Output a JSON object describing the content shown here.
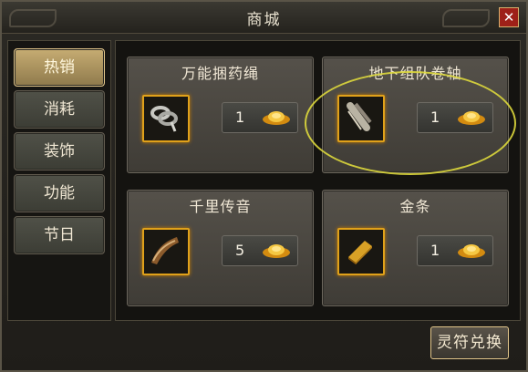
{
  "window": {
    "title": "商城"
  },
  "sidebar": {
    "tabs": [
      {
        "label": "热销",
        "active": true
      },
      {
        "label": "消耗",
        "active": false
      },
      {
        "label": "装饰",
        "active": false
      },
      {
        "label": "功能",
        "active": false
      },
      {
        "label": "节日",
        "active": false
      }
    ]
  },
  "items": [
    {
      "name": "万能捆药绳",
      "price": "1",
      "icon": "rope-icon"
    },
    {
      "name": "地下组队卷轴",
      "price": "1",
      "icon": "scroll-icon"
    },
    {
      "name": "千里传音",
      "price": "5",
      "icon": "horn-icon"
    },
    {
      "name": "金条",
      "price": "1",
      "icon": "gold-bar-icon"
    }
  ],
  "footer": {
    "exchange_label": "灵符兑换"
  },
  "colors": {
    "accent_gold": "#e0a11a",
    "highlight": "#ddd83c",
    "close_red": "#9e2018"
  }
}
